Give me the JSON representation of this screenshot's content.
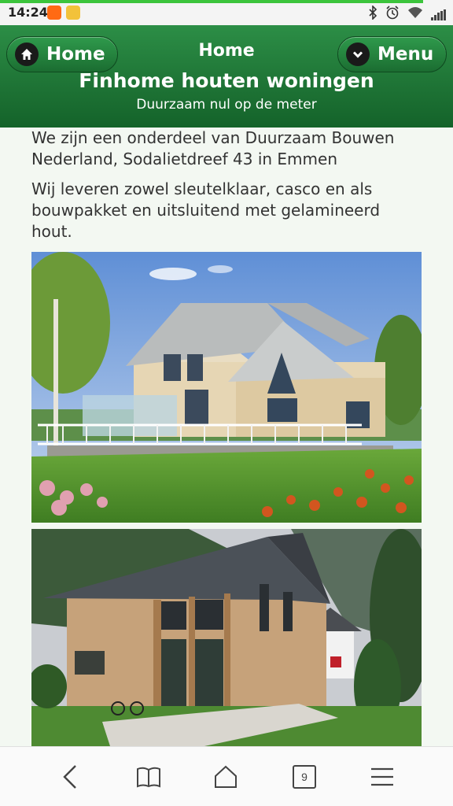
{
  "status": {
    "time": "14:24",
    "icons": [
      "app-notification-icon",
      "app-notification-icon",
      "bluetooth-icon",
      "alarm-icon",
      "wifi-icon",
      "signal-icon"
    ]
  },
  "header": {
    "page_title": "Home",
    "home_button": "Home",
    "menu_button": "Menu",
    "site_title": "Finhome houten woningen",
    "tagline": "Duurzaam nul op de meter"
  },
  "main": {
    "paragraph1": "We zijn een onderdeel van Duurzaam Bouwen Nederland, Sodalietdreef 43 in Emmen",
    "paragraph2": "Wij leveren zowel sleutelklaar, casco en als bouwpakket en uitsluitend met gelamineerd hout.",
    "images": [
      "photo-wooden-house-with-terrace",
      "photo-wooden-house-mountains"
    ]
  },
  "bottom_nav": {
    "tab_count": "9",
    "icons": [
      "back-icon",
      "bookmarks-icon",
      "home-icon",
      "tabs-icon",
      "menu-icon"
    ]
  },
  "colors": {
    "header_green": "#1e7335",
    "content_bg": "#f3f8f2",
    "progress": "#3cc43c"
  }
}
